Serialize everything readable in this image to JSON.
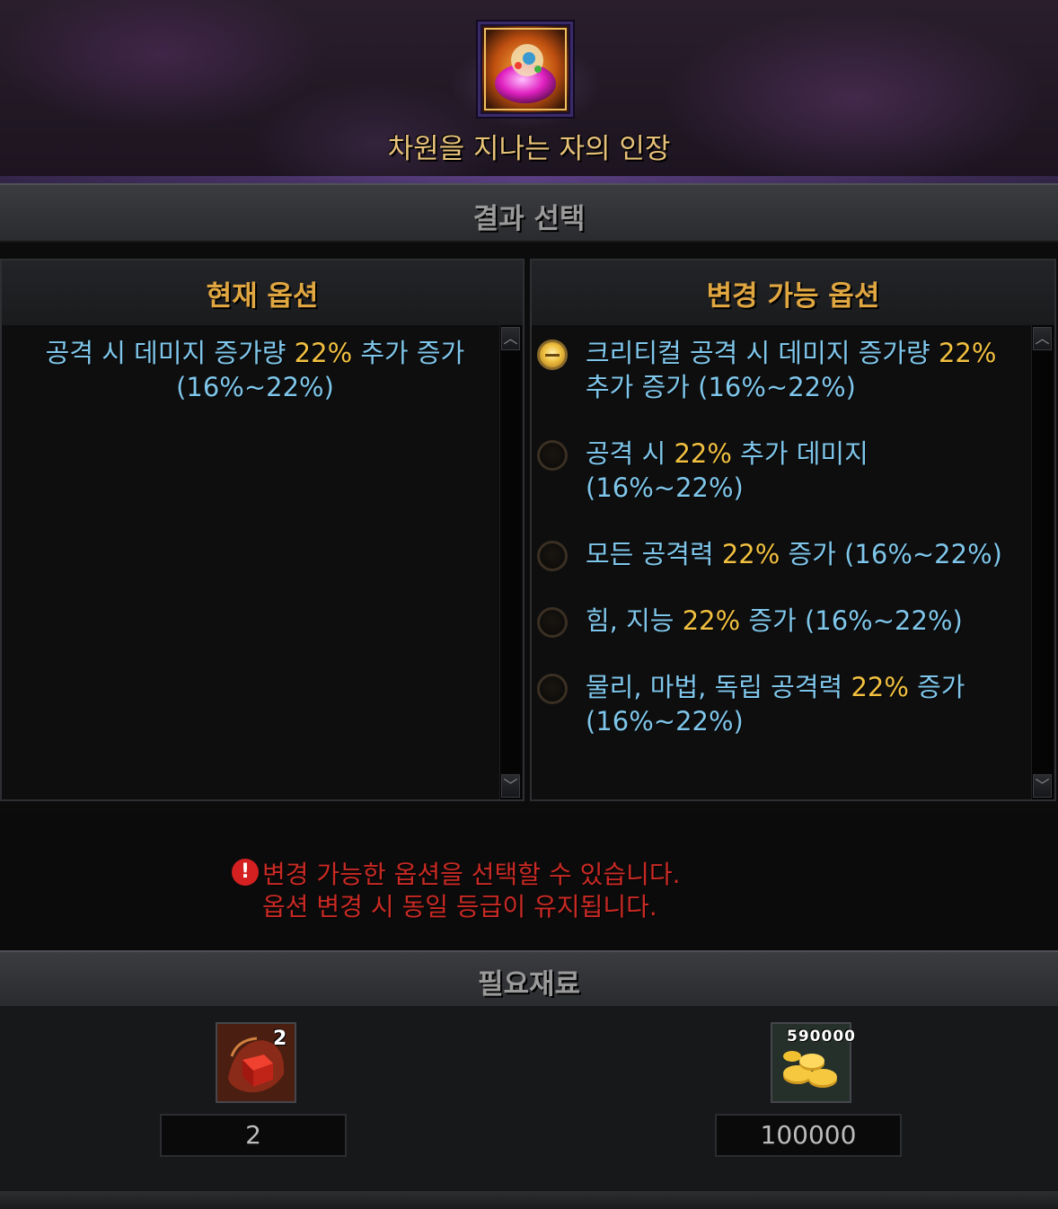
{
  "item": {
    "name": "차원을 지나는 자의 인장",
    "icon": "seal-orb-icon"
  },
  "section_result": "결과 선택",
  "current_panel": {
    "title": "현재 옵션",
    "option_prefix": "공격 시 데미지 증가량 ",
    "option_value": "22%",
    "option_suffix": " 추가 증가 (16%~22%)"
  },
  "changeable_panel": {
    "title": "변경 가능 옵션",
    "options": [
      {
        "prefix": "크리티컬 공격 시 데미지 증가량 ",
        "value": "22%",
        "suffix": " 추가 증가 (16%~22%)",
        "selected": true
      },
      {
        "prefix": "공격 시 ",
        "value": "22%",
        "suffix": " 추가 데미지 (16%~22%)",
        "selected": false
      },
      {
        "prefix": "모든 공격력 ",
        "value": "22%",
        "suffix": " 증가 (16%~22%)",
        "selected": false
      },
      {
        "prefix": "힘, 지능 ",
        "value": "22%",
        "suffix": " 증가 (16%~22%)",
        "selected": false
      },
      {
        "prefix": "물리, 마법, 독립 공격력 ",
        "value": "22%",
        "suffix": " 증가 (16%~22%)",
        "selected": false
      }
    ]
  },
  "notice": {
    "line1": "변경 가능한 옵션을 선택할 수 있습니다.",
    "line2": "옵션 변경 시 동일 등급이 유지됩니다."
  },
  "section_materials": "필요재료",
  "materials": [
    {
      "icon": "red-cube-icon",
      "badge": "2",
      "count": "2"
    },
    {
      "icon": "gold-coins-icon",
      "badge": "590000",
      "count": "100000"
    }
  ],
  "colors": {
    "accent_gold": "#e0a640",
    "option_blue": "#7fc6ea",
    "value_yellow": "#f1c040",
    "warning_red": "#c82a24"
  }
}
